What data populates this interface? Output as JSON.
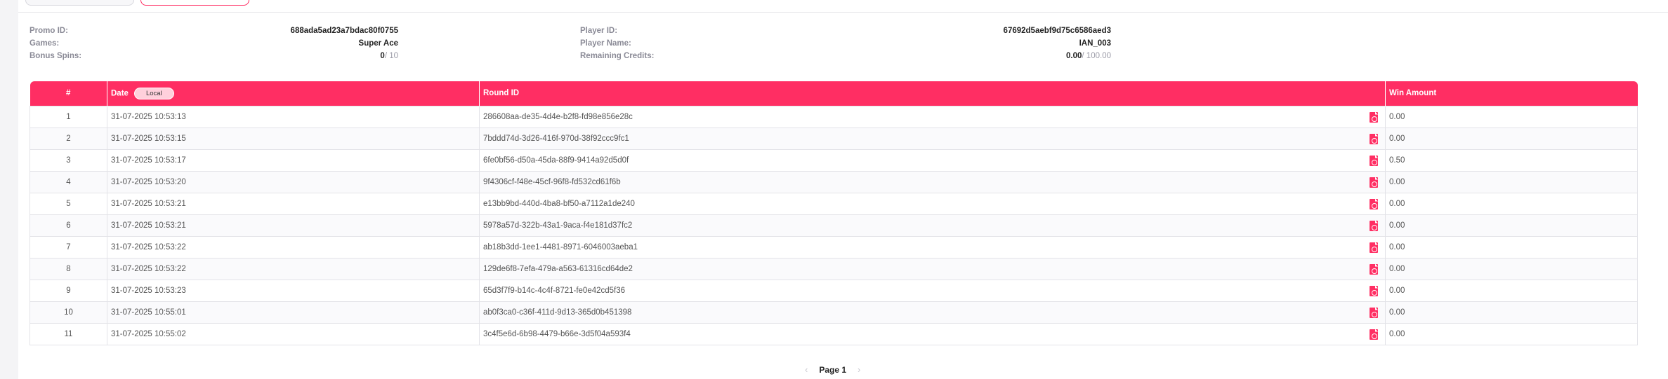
{
  "info": {
    "promo_id_label": "Promo ID:",
    "promo_id": "688ada5ad23a7bdac80f0755",
    "games_label": "Games:",
    "games": "Super Ace",
    "bonus_spins_label": "Bonus Spins:",
    "bonus_spins_used": "0",
    "bonus_spins_total": "/ 10",
    "player_id_label": "Player ID:",
    "player_id": "67692d5aebf9d75c6586aed3",
    "player_name_label": "Player Name:",
    "player_name": "IAN_003",
    "remaining_credits_label": "Remaining Credits:",
    "remaining_credits": "0.00",
    "remaining_credits_total": "/ 100.00"
  },
  "table": {
    "headers": {
      "num": "#",
      "date": "Date",
      "local": "Local",
      "round": "Round ID",
      "win": "Win Amount"
    },
    "rows": [
      {
        "num": "1",
        "date": "31-07-2025 10:53:13",
        "round": "286608aa-de35-4d4e-b2f8-fd98e856e28c",
        "win": "0.00"
      },
      {
        "num": "2",
        "date": "31-07-2025 10:53:15",
        "round": "7bddd74d-3d26-416f-970d-38f92ccc9fc1",
        "win": "0.00"
      },
      {
        "num": "3",
        "date": "31-07-2025 10:53:17",
        "round": "6fe0bf56-d50a-45da-88f9-9414a92d5d0f",
        "win": "0.50"
      },
      {
        "num": "4",
        "date": "31-07-2025 10:53:20",
        "round": "9f4306cf-f48e-45cf-96f8-fd532cd61f6b",
        "win": "0.00"
      },
      {
        "num": "5",
        "date": "31-07-2025 10:53:21",
        "round": "e13bb9bd-440d-4ba8-bf50-a7112a1de240",
        "win": "0.00"
      },
      {
        "num": "6",
        "date": "31-07-2025 10:53:21",
        "round": "5978a57d-322b-43a1-9aca-f4e181d37fc2",
        "win": "0.00"
      },
      {
        "num": "7",
        "date": "31-07-2025 10:53:22",
        "round": "ab18b3dd-1ee1-4481-8971-6046003aeba1",
        "win": "0.00"
      },
      {
        "num": "8",
        "date": "31-07-2025 10:53:22",
        "round": "129de6f8-7efa-479a-a563-61316cd64de2",
        "win": "0.00"
      },
      {
        "num": "9",
        "date": "31-07-2025 10:53:23",
        "round": "65d3f7f9-b14c-4c4f-8721-fe0e42cd5f36",
        "win": "0.00"
      },
      {
        "num": "10",
        "date": "31-07-2025 10:55:01",
        "round": "ab0f3ca0-c36f-411d-9d13-365d0b451398",
        "win": "0.00"
      },
      {
        "num": "11",
        "date": "31-07-2025 10:55:02",
        "round": "3c4f5e6d-6b98-4479-b66e-3d5f04a593f4",
        "win": "0.00"
      }
    ]
  },
  "pager": {
    "label": "Page 1",
    "prev": "‹",
    "next": "›"
  },
  "colors": {
    "accent": "#ff2e63"
  },
  "icons": {
    "row_action": "pdf-icon"
  }
}
